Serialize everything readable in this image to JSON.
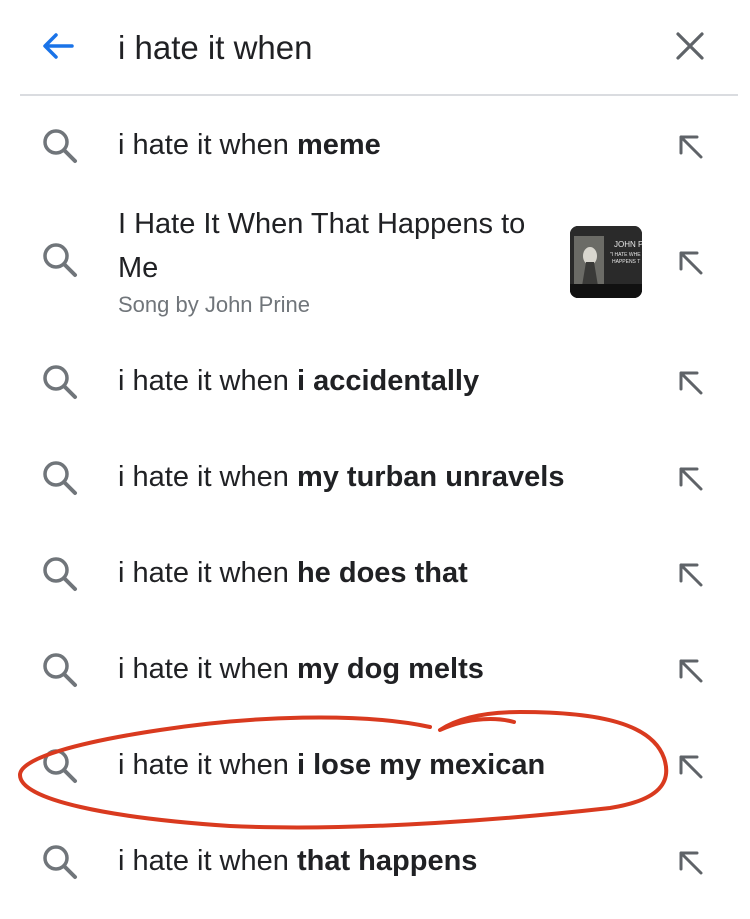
{
  "search": {
    "query": "i hate it when"
  },
  "suggestions": [
    {
      "prefix": "i hate it when ",
      "bold": "meme"
    },
    {
      "rich_title": "I Hate It When That Happens to Me",
      "rich_subtitle": "Song by John Prine",
      "thumbnail_icon": "album-art-thumbnail"
    },
    {
      "prefix": "i hate it when ",
      "bold": "i accidentally"
    },
    {
      "prefix": "i hate it when ",
      "bold": "my turban unravels"
    },
    {
      "prefix": "i hate it when ",
      "bold": "he does that"
    },
    {
      "prefix": "i hate it when ",
      "bold": "my dog melts"
    },
    {
      "prefix": "i hate it when ",
      "bold": "i lose my mexican"
    },
    {
      "prefix": "i hate it when ",
      "bold": "that happens"
    }
  ],
  "thumbnail": {
    "text_lines": [
      "JOHN P",
      "\"I HATE WHE",
      "HAPPENS T"
    ]
  },
  "colors": {
    "accent": "#1a73e8",
    "icon_gray": "#70757a",
    "text": "#202124",
    "annotation_red": "#d93a1f"
  }
}
